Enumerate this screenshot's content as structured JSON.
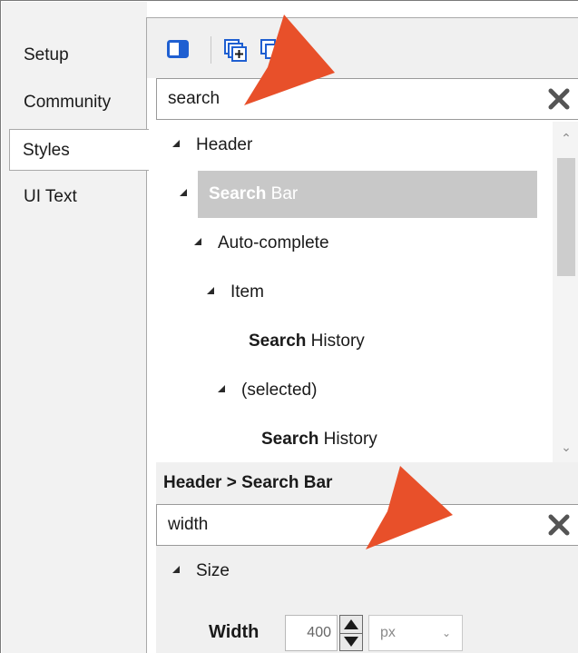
{
  "tabs": [
    {
      "label": "Setup",
      "selected": false
    },
    {
      "label": "Community",
      "selected": false
    },
    {
      "label": "Styles",
      "selected": true
    },
    {
      "label": "UI Text",
      "selected": false
    }
  ],
  "toolbar": {
    "icons": [
      "panel-toggle-icon",
      "add-copy-icon",
      "copy-icon"
    ]
  },
  "style_search": {
    "value": "search"
  },
  "tree": {
    "nodes": [
      {
        "pre": "",
        "bold": "",
        "post": "Header",
        "expanded": true,
        "highlighted": false
      },
      {
        "pre": "",
        "bold": "Search",
        "post": " Bar",
        "expanded": true,
        "highlighted": true
      },
      {
        "pre": "",
        "bold": "",
        "post": "Auto-complete",
        "expanded": true,
        "highlighted": false
      },
      {
        "pre": "",
        "bold": "",
        "post": "Item",
        "expanded": true,
        "highlighted": false
      },
      {
        "pre": "",
        "bold": "Search",
        "post": " History",
        "expanded": false,
        "highlighted": false
      },
      {
        "pre": "",
        "bold": "",
        "post": "(selected)",
        "expanded": true,
        "highlighted": false
      },
      {
        "pre": "",
        "bold": "Search",
        "post": " History",
        "expanded": false,
        "highlighted": false
      }
    ]
  },
  "properties": {
    "breadcrumb": "Header > Search Bar",
    "search_value": "width",
    "group_label": "Size",
    "width_label": "Width",
    "width_value": "400",
    "unit": "px"
  },
  "colors": {
    "accent_blue": "#1f5fd1",
    "pointer_orange": "#e8502a"
  }
}
